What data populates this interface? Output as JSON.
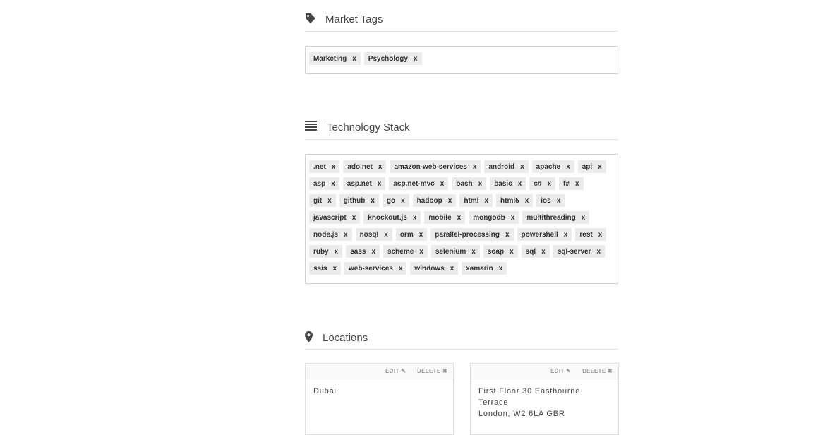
{
  "market": {
    "title": "Market Tags",
    "icon": "tag-icon",
    "remove_label": "x",
    "tags": [
      "Marketing",
      "Psychology"
    ]
  },
  "tech": {
    "title": "Technology Stack",
    "icon": "stack-icon",
    "remove_label": "x",
    "tags": [
      ".net",
      "ado.net",
      "amazon-web-services",
      "android",
      "apache",
      "api",
      "asp",
      "asp.net",
      "asp.net-mvc",
      "bash",
      "basic",
      "c#",
      "f#",
      "git",
      "github",
      "go",
      "hadoop",
      "html",
      "html5",
      "ios",
      "javascript",
      "knockout.js",
      "mobile",
      "mongodb",
      "multithreading",
      "node.js",
      "nosql",
      "orm",
      "parallel-processing",
      "powershell",
      "rest",
      "ruby",
      "sass",
      "scheme",
      "selenium",
      "soap",
      "sql",
      "sql-server",
      "ssis",
      "web-services",
      "windows",
      "xamarin"
    ]
  },
  "locations": {
    "title": "Locations",
    "icon": "map-pin-icon",
    "edit_label": "EDIT",
    "delete_label": "DELETE",
    "cards": [
      {
        "line1": "Dubai",
        "line2": ""
      },
      {
        "line1": "First Floor 30 Eastbourne Terrace",
        "line2": "London, W2 6LA GBR"
      }
    ]
  }
}
